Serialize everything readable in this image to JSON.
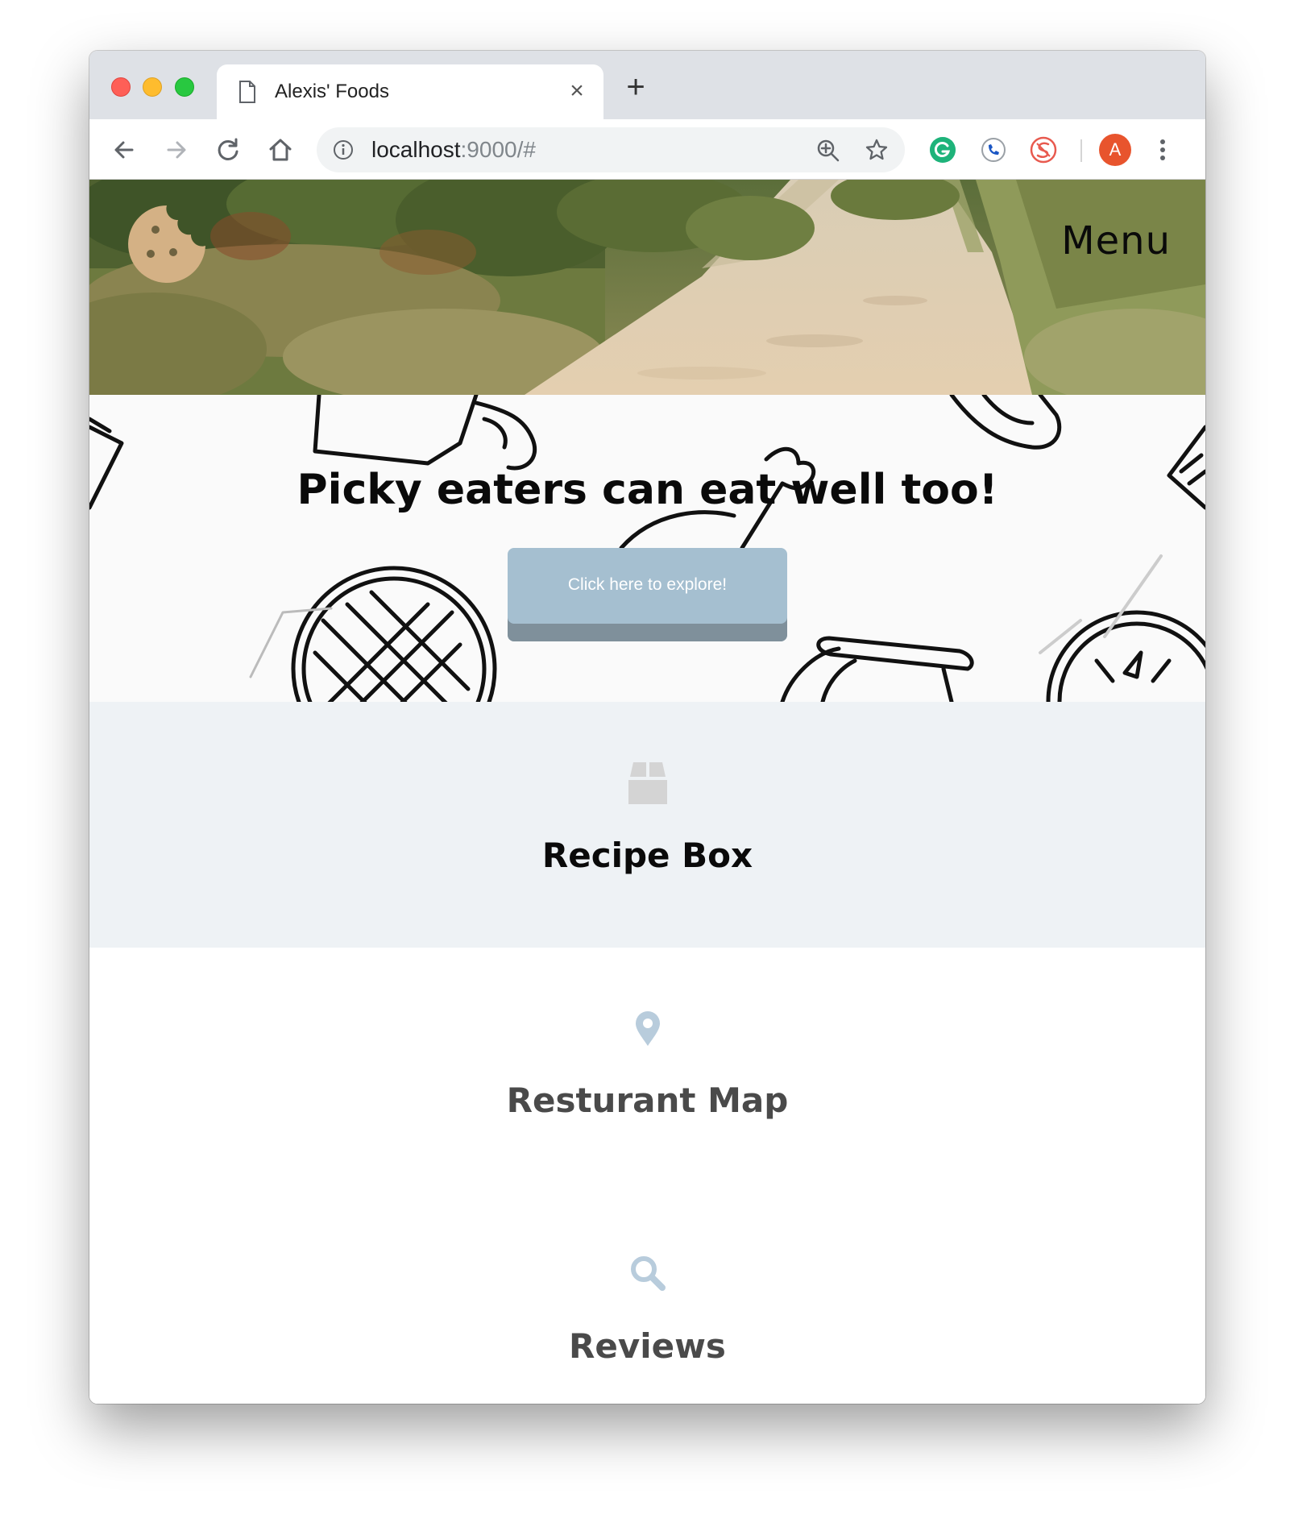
{
  "browser": {
    "tab_title": "Alexis' Foods",
    "url_host": "localhost",
    "url_rest": ":9000/#",
    "avatar_letter": "A",
    "icons": [
      "page-icon",
      "close-icon",
      "plus-icon",
      "back-arrow-icon",
      "forward-arrow-icon",
      "reload-icon",
      "home-icon",
      "info-icon",
      "zoom-icon",
      "star-icon",
      "grammarly-icon",
      "phone-extension-icon",
      "extension-icon",
      "kebab-menu-icon"
    ]
  },
  "header": {
    "menu_label": "Menu",
    "logo_icon": "cookie-icon"
  },
  "banner": {
    "tagline": "Picky eaters can eat well too!",
    "button_label": "Click here to explore!"
  },
  "features": [
    {
      "title": "Recipe Box",
      "icon": "box-icon"
    },
    {
      "title": "Resturant Map",
      "icon": "map-pin-icon"
    },
    {
      "title": "Reviews",
      "icon": "search-icon"
    }
  ],
  "colors": {
    "accent": "#a5bfd0",
    "accent_shadow": "#7f909b",
    "cookie": "#d4b185",
    "feature_band": "#eef2f5",
    "icon_blue": "#b8ccdc"
  }
}
